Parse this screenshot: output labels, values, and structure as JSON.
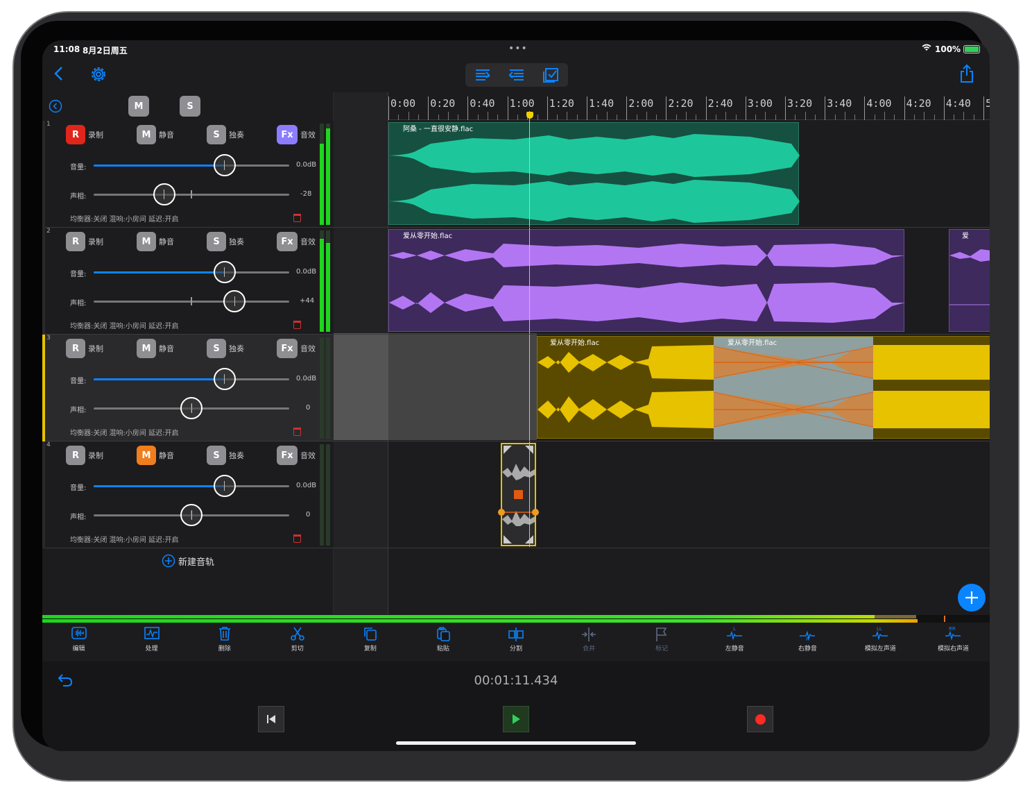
{
  "status": {
    "time": "11:08",
    "date": "8月2日周五",
    "battery": "100%"
  },
  "toolbar": {
    "back_icon": "chevron-left-icon",
    "settings_icon": "gear-icon",
    "share_icon": "share-icon"
  },
  "mixer_header": {
    "m_label": "M",
    "s_label": "S"
  },
  "tracks": [
    {
      "num": "1",
      "r": "R",
      "rec": "录制",
      "m": "M",
      "mute": "静音",
      "s": "S",
      "solo": "独奏",
      "fx": "Fx",
      "fxl": "音效",
      "vol_label": "音量:",
      "vol": "0.0dB",
      "vol_level": 0.67,
      "pan_label": "声相:",
      "pan": "-28",
      "pan_level": 0.36,
      "info": "均衡器:关闭 混响:小房间 延迟:开启",
      "r_color": "#e0261b",
      "m_color": "#8e8e93",
      "fx_color": "#8c7dff",
      "color": "#12b28f"
    },
    {
      "num": "2",
      "r": "R",
      "rec": "录制",
      "m": "M",
      "mute": "静音",
      "s": "S",
      "solo": "独奏",
      "fx": "Fx",
      "fxl": "音效",
      "vol_label": "音量:",
      "vol": "0.0dB",
      "vol_level": 0.67,
      "pan_label": "声相:",
      "pan": "+44",
      "pan_level": 0.72,
      "info": "均衡器:关闭 混响:小房间 延迟:开启",
      "r_color": "#8e8e93",
      "m_color": "#8e8e93",
      "fx_color": "#8e8e93",
      "color": "#b276f3"
    },
    {
      "num": "3",
      "r": "R",
      "rec": "录制",
      "m": "M",
      "mute": "静音",
      "s": "S",
      "solo": "独奏",
      "fx": "Fx",
      "fxl": "音效",
      "vol_label": "音量:",
      "vol": "0.0dB",
      "vol_level": 0.67,
      "pan_label": "声相:",
      "pan": "0",
      "pan_level": 0.5,
      "info": "均衡器:关闭 混响:小房间 延迟:开启",
      "r_color": "#8e8e93",
      "m_color": "#8e8e93",
      "fx_color": "#8e8e93",
      "color": "#e6c200"
    },
    {
      "num": "4",
      "r": "R",
      "rec": "录制",
      "m": "M",
      "mute": "静音",
      "s": "S",
      "solo": "独奏",
      "fx": "Fx",
      "fxl": "音效",
      "vol_label": "音量:",
      "vol": "0.0dB",
      "vol_level": 0.67,
      "pan_label": "声相:",
      "pan": "0",
      "pan_level": 0.5,
      "info": "均衡器:关闭 混响:小房间 延迟:开启",
      "r_color": "#8e8e93",
      "m_color": "#f07d1e",
      "fx_color": "#8e8e93",
      "color": "#aaaaaa"
    }
  ],
  "new_track": "新建音轨",
  "ruler": [
    "0:00",
    "0:20",
    "0:40",
    "1:00",
    "1:20",
    "1:40",
    "2:00",
    "2:20",
    "2:40",
    "3:00",
    "3:20",
    "3:40",
    "4:00",
    "4:20",
    "4:40",
    "5"
  ],
  "clips": {
    "clip1": "阿桑 - 一直很安静.flac",
    "clip2": "爱从零开始.flac",
    "clip2b": "爱",
    "clip3": "爱从零开始.flac",
    "clip3b": "爱从零开始.flac"
  },
  "tools": [
    {
      "label": "编辑",
      "icon": "waveform-icon",
      "on": true
    },
    {
      "label": "处理",
      "icon": "process-icon",
      "on": true
    },
    {
      "label": "删除",
      "icon": "trash-icon",
      "on": true
    },
    {
      "label": "剪切",
      "icon": "scissors-icon",
      "on": true
    },
    {
      "label": "复制",
      "icon": "copy-icon",
      "on": true
    },
    {
      "label": "粘贴",
      "icon": "paste-icon",
      "on": true
    },
    {
      "label": "分割",
      "icon": "split-icon",
      "on": true
    },
    {
      "label": "合并",
      "icon": "merge-icon",
      "on": false
    },
    {
      "label": "标记",
      "icon": "flag-icon",
      "on": false
    },
    {
      "label": "左静音",
      "icon": "left-mute-icon",
      "on": true
    },
    {
      "label": "右静音",
      "icon": "right-mute-icon",
      "on": true
    },
    {
      "label": "模拟左声道",
      "icon": "left-channel-icon",
      "on": true
    },
    {
      "label": "模拟右声道",
      "icon": "right-channel-icon",
      "on": true
    }
  ],
  "transport": {
    "time": "00:01:11.434",
    "undo_icon": "undo-icon",
    "rewind_icon": "skip-back-icon",
    "play_icon": "play-icon",
    "record_icon": "record-icon"
  }
}
